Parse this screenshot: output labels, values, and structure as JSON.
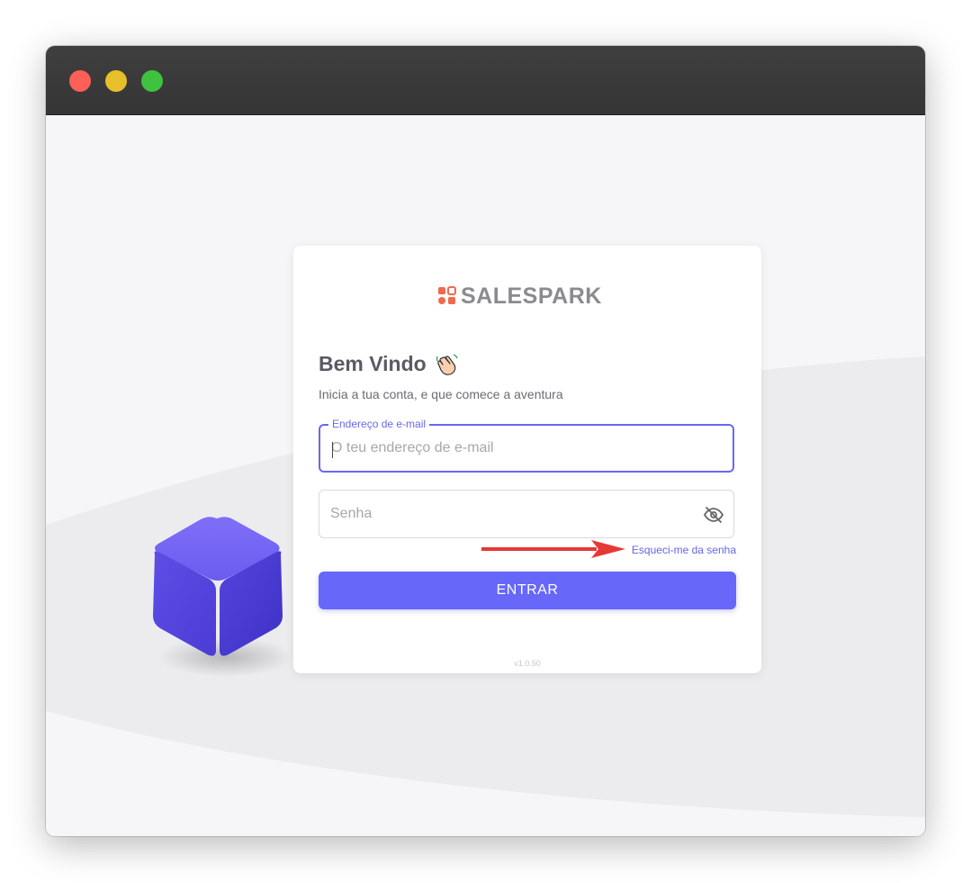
{
  "brand": {
    "name": "SALESPARK",
    "colors": {
      "accent": "#6767f9",
      "logo_mark": "#f06a4f",
      "logo_text": "#8a8a90"
    }
  },
  "window": {
    "controls": [
      "close",
      "minimize",
      "maximize"
    ]
  },
  "login": {
    "title": "Bem Vindo",
    "title_emoji_icon": "waving-hand-icon",
    "subtitle": "Inicia a tua conta, e que comece a aventura",
    "email": {
      "label": "Endereço de e-mail",
      "placeholder": "O teu endereço de e-mail",
      "value": ""
    },
    "password": {
      "placeholder": "Senha",
      "value": "",
      "toggle_icon": "eye-off-icon"
    },
    "forgot_link": "Esqueci-me da senha",
    "submit_label": "ENTRAR",
    "version": "v1.0.50"
  },
  "annotation": {
    "arrow_icon": "red-arrow-icon",
    "color": "#e53935"
  }
}
